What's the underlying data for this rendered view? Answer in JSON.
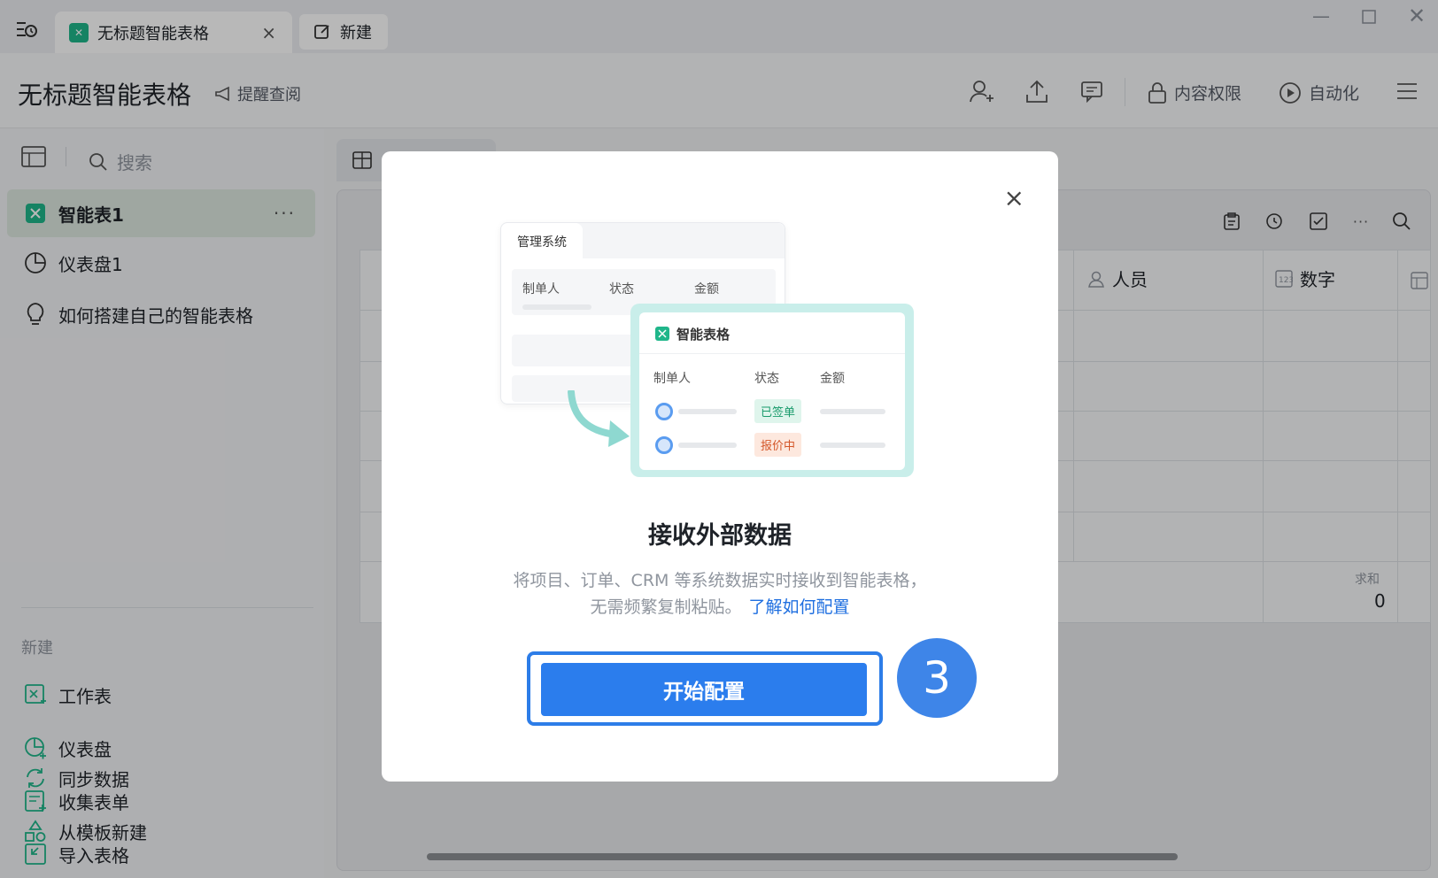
{
  "titlebar": {
    "tabs": [
      {
        "label": "无标题智能表格",
        "close": "×"
      },
      {
        "label": "新建"
      }
    ]
  },
  "header": {
    "title": "无标题智能表格",
    "remind": "提醒查阅",
    "permission": "内容权限",
    "automation": "自动化"
  },
  "sidebar": {
    "search_placeholder": "搜索",
    "items": [
      {
        "label": "智能表1",
        "more": "···"
      },
      {
        "label": "仪表盘1"
      },
      {
        "label": "如何搭建自己的智能表格"
      }
    ],
    "new_section": "新建",
    "new_items": [
      {
        "label": "工作表"
      },
      {
        "label": "仪表盘"
      },
      {
        "label": "收集表单"
      },
      {
        "label": "导入表格"
      },
      {
        "label": "同步数据"
      },
      {
        "label": "从模板新建"
      }
    ]
  },
  "grid": {
    "columns": [
      {
        "label": "人员"
      },
      {
        "label": "数字"
      }
    ],
    "sum_label": "求和",
    "sum_value": "0"
  },
  "dialog": {
    "illustration": {
      "back_tab": "管理系统",
      "back_cols": [
        "制单人",
        "状态",
        "金额"
      ],
      "front_title": "智能表格",
      "front_cols": [
        "制单人",
        "状态",
        "金额"
      ],
      "status_signed": "已签单",
      "status_quoting": "报价中"
    },
    "title": "接收外部数据",
    "desc_line1": "将项目、订单、CRM 等系统数据实时接收到智能表格，",
    "desc_line2": "无需频繁复制粘贴。",
    "link": "了解如何配置",
    "start_button": "开始配置",
    "close": "×"
  },
  "step_badge": "3",
  "colors": {
    "accent": "#2b7ded",
    "brand_green": "#1fb68a",
    "link": "#1f6fe0"
  }
}
